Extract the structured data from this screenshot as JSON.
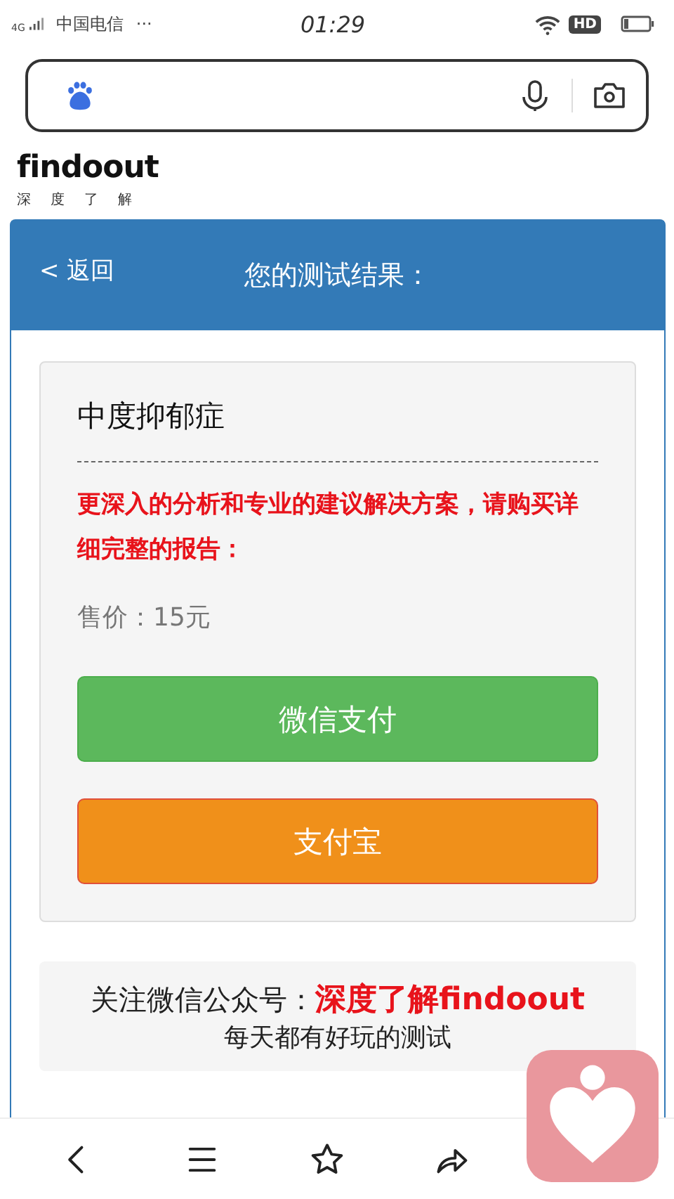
{
  "status_bar": {
    "network": "4G",
    "carrier": "中国电信",
    "more": "···",
    "time": "01:29",
    "hd": "HD"
  },
  "logo": {
    "name": "findoout",
    "tagline": [
      "深",
      "度",
      "了",
      "解"
    ]
  },
  "header": {
    "back": "< 返回",
    "title": "您的测试结果："
  },
  "result": {
    "test_name": "中度抑郁症",
    "notice": "更深入的分析和专业的建议解决方案，请购买详细完整的报告：",
    "price": "售价：15元",
    "buttons": [
      {
        "label": "微信支付",
        "kind": "wechat"
      },
      {
        "label": "支付宝",
        "kind": "alipay"
      }
    ]
  },
  "footer": {
    "follow_label": "关注微信公众号：",
    "account": "深度了解findoout",
    "slogan": "每天都有好玩的测试"
  }
}
